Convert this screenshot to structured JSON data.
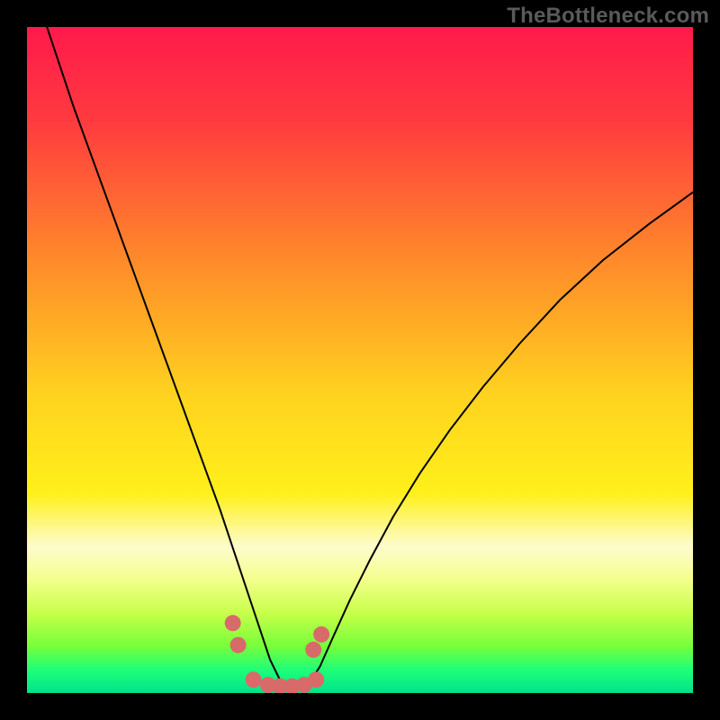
{
  "watermark": "TheBottleneck.com",
  "chart_data": {
    "type": "line",
    "title": "",
    "xlabel": "",
    "ylabel": "",
    "xlim": [
      0,
      100
    ],
    "ylim": [
      0,
      100
    ],
    "grid": false,
    "legend": false,
    "background_gradient_stops": [
      {
        "offset": 0.0,
        "color": "#ff1a4b"
      },
      {
        "offset": 0.14,
        "color": "#ff3a3f"
      },
      {
        "offset": 0.35,
        "color": "#ff8a2a"
      },
      {
        "offset": 0.55,
        "color": "#ffd21f"
      },
      {
        "offset": 0.7,
        "color": "#fff01a"
      },
      {
        "offset": 0.78,
        "color": "#fdfccc"
      },
      {
        "offset": 0.83,
        "color": "#f3ff8c"
      },
      {
        "offset": 0.88,
        "color": "#c8ff4a"
      },
      {
        "offset": 0.93,
        "color": "#76ff3a"
      },
      {
        "offset": 0.965,
        "color": "#1fff78"
      },
      {
        "offset": 1.0,
        "color": "#00e38a"
      }
    ],
    "series": [
      {
        "name": "left-curve",
        "stroke": "#000000",
        "width": 2,
        "x": [
          3,
          5,
          7,
          9,
          11,
          13,
          15,
          17,
          19,
          21,
          23,
          25,
          27,
          29,
          30.5,
          32,
          33.5,
          35,
          36.5,
          38.5
        ],
        "y": [
          100,
          94,
          88,
          82.5,
          77,
          71.5,
          66,
          60.5,
          55,
          49.5,
          44,
          38.5,
          33,
          27.5,
          23,
          18.5,
          14,
          9.5,
          5,
          0.9
        ]
      },
      {
        "name": "right-curve",
        "stroke": "#000000",
        "width": 2,
        "x": [
          42,
          44,
          46,
          48.5,
          51.5,
          55,
          59,
          63.5,
          68.5,
          74,
          80,
          86.5,
          93.5,
          100
        ],
        "y": [
          0.9,
          4,
          8.5,
          14,
          20,
          26.5,
          33,
          39.5,
          46,
          52.5,
          59,
          65,
          70.5,
          75.2
        ]
      },
      {
        "name": "marker-dots",
        "type": "scatter",
        "color": "#d86a6a",
        "radius": 9,
        "x": [
          30.9,
          31.7,
          34.0,
          36.2,
          38.0,
          39.8,
          41.6,
          43.4,
          43.0,
          44.2
        ],
        "y": [
          10.5,
          7.2,
          2.0,
          1.2,
          1.0,
          1.0,
          1.2,
          2.0,
          6.5,
          8.8
        ]
      }
    ]
  }
}
